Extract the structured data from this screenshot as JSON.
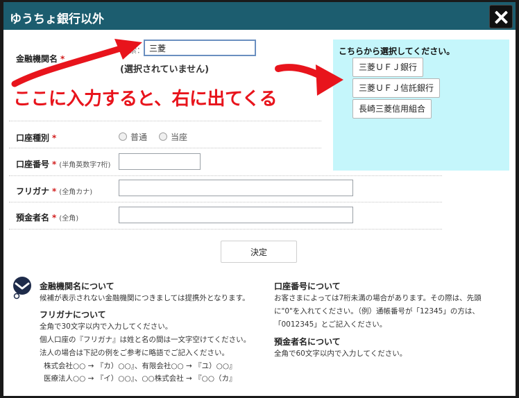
{
  "dialog": {
    "title": "ゆうちょ銀行以外"
  },
  "form": {
    "bank": {
      "label": "金融機関名",
      "required_mark": "*",
      "search_label": "検索：",
      "search_value": "三菱",
      "status": "(選択されていません)"
    },
    "account_type": {
      "label": "口座種別",
      "required_mark": "*",
      "options": [
        "普通",
        "当座"
      ]
    },
    "account_number": {
      "label": "口座番号",
      "required_mark": "*",
      "note": "(半角英数字7桁)",
      "value": ""
    },
    "furigana": {
      "label": "フリガナ",
      "required_mark": "*",
      "note": "(全角カナ)",
      "value": ""
    },
    "holder": {
      "label": "預金者名",
      "required_mark": "*",
      "note": "(全角)",
      "value": ""
    },
    "submit_label": "決定"
  },
  "annotation": {
    "text": "ここに入力すると、右に出てくる",
    "color": "#e8141c"
  },
  "results": {
    "title": "こちらから選択してください。",
    "items": [
      "三菱ＵＦＪ銀行",
      "三菱ＵＦＪ信託銀行",
      "長崎三菱信用組合"
    ]
  },
  "help": {
    "bank": {
      "title": "金融機関名について",
      "lines": [
        "候補が表示されない金融機関につきましては提携外となります。"
      ]
    },
    "furigana": {
      "title": "フリガナについて",
      "lines": [
        "全角で30文字以内で入力してください。",
        "個人口座の『フリガナ』は姓と名の間は一文字空けてください。",
        "法人の場合は下記の例をご参考に略語でご記入ください。",
        "株式会社○○ → 『カ）○○』、有限会社○○ → 『ユ）○○』",
        "医療法人○○ → 『イ）○○』、○○株式会社 → 『○○（カ』"
      ]
    },
    "account_number": {
      "title": "口座番号について",
      "lines": [
        "お客さまによっては7桁未満の場合があります。その際は、先頭",
        "に\"0\"を入れてください。（例）通帳番号が「12345」の方は、",
        "「0012345」とご記入ください。"
      ]
    },
    "holder": {
      "title": "預金者名について",
      "lines": [
        "全角で60文字以内で入力してください。"
      ]
    }
  },
  "colors": {
    "titlebar": "#1c5d6f",
    "panel": "#c5f6fb",
    "required": "#d21e1e"
  }
}
